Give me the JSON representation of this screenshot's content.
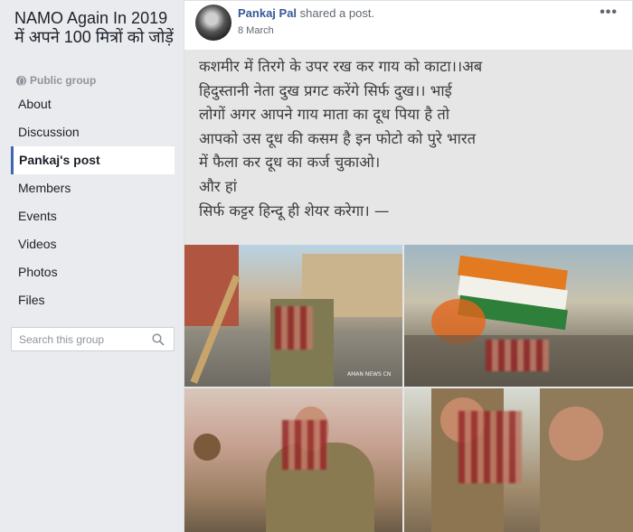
{
  "sidebar": {
    "group_title": "NAMO Again In 2019 में अपने 100 मित्रों को जोड़ें",
    "privacy": "Public group",
    "nav": [
      {
        "label": "About"
      },
      {
        "label": "Discussion"
      },
      {
        "label": "Pankaj's post",
        "active": true
      },
      {
        "label": "Members"
      },
      {
        "label": "Events"
      },
      {
        "label": "Videos"
      },
      {
        "label": "Photos"
      },
      {
        "label": "Files"
      }
    ],
    "search": {
      "placeholder": "Search this group",
      "icon": "search-icon"
    }
  },
  "post": {
    "author": "Pankaj Pal",
    "action": "shared a post.",
    "date": "8 March",
    "menu": "•••",
    "shared_text": [
      "कशमीर में तिरगे के उपर रख कर गाय को काटा।।अब",
      "हिदुस्तानी नेता दुख प्रगट करेंगे सिर्फ दुख।। भाई",
      "लोगों अगर आपने गाय माता का दूध पिया है तो",
      "आपको उस दूध की कसम है इन फोटो को पुरे भारत",
      "में फैला कर दूध का कर्ज चुकाओ।",
      "और हां",
      "सिर्फ कट्टर हिन्दू ही शेयर करेगा। —"
    ],
    "photo_watermark": "AMAN NEWS CN"
  },
  "colors": {
    "link": "#385898",
    "accent": "#4267b2",
    "page_bg": "#e9ebee"
  }
}
